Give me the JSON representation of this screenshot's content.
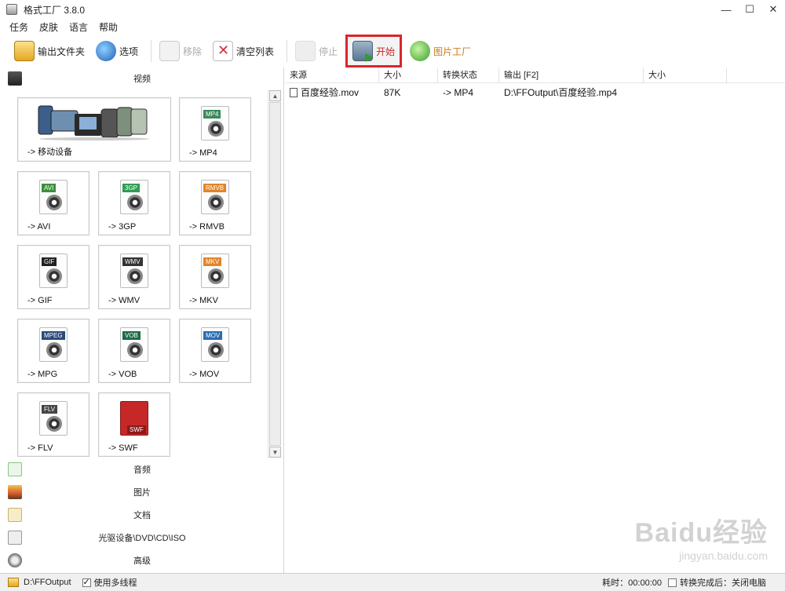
{
  "window": {
    "title": "格式工厂 3.8.0",
    "controls": [
      "—",
      "☐",
      "✕"
    ]
  },
  "menu": [
    "任务",
    "皮肤",
    "语言",
    "帮助"
  ],
  "toolbar": {
    "output_folder": "输出文件夹",
    "options": "选项",
    "remove": "移除",
    "clear_list": "清空列表",
    "stop": "停止",
    "start": "开始",
    "picture_factory": "图片工厂"
  },
  "categories": {
    "video": "视频",
    "audio": "音频",
    "image": "图片",
    "document": "文档",
    "disc": "光驱设备\\DVD\\CD\\ISO",
    "advanced": "高级"
  },
  "video_tiles": [
    {
      "label": "-> 移动设备",
      "tag": "",
      "icon": "mobile-devices-icon"
    },
    {
      "label": "-> MP4",
      "tag": "MP4",
      "tag_color": "#3a8a5c",
      "icon": "mp4-icon"
    },
    {
      "label": "-> AVI",
      "tag": "AVI",
      "tag_color": "#3c8f3c",
      "icon": "avi-icon"
    },
    {
      "label": "-> 3GP",
      "tag": "3GP",
      "tag_color": "#2f9d52",
      "icon": "3gp-icon"
    },
    {
      "label": "-> RMVB",
      "tag": "RMVB",
      "tag_color": "#e48427",
      "icon": "rmvb-icon"
    },
    {
      "label": "-> GIF",
      "tag": "GIF",
      "tag_color": "#222222",
      "icon": "gif-icon"
    },
    {
      "label": "-> WMV",
      "tag": "WMV",
      "tag_color": "#333333",
      "icon": "wmv-icon"
    },
    {
      "label": "-> MKV",
      "tag": "MKV",
      "tag_color": "#e48427",
      "icon": "mkv-icon"
    },
    {
      "label": "-> MPG",
      "tag": "MPEG",
      "tag_color": "#2d4a7a",
      "icon": "mpg-icon"
    },
    {
      "label": "-> VOB",
      "tag": "VOB",
      "tag_color": "#1e6b46",
      "icon": "vob-icon"
    },
    {
      "label": "-> MOV",
      "tag": "MOV",
      "tag_color": "#2a6db0",
      "icon": "mov-icon"
    },
    {
      "label": "-> FLV",
      "tag": "FLV",
      "tag_color": "#444444",
      "icon": "flv-icon"
    },
    {
      "label": "-> SWF",
      "tag": "SWF",
      "tag_color": "#c62828",
      "icon": "swf-icon"
    }
  ],
  "table": {
    "columns": [
      "来源",
      "大小",
      "转换状态",
      "输出 [F2]",
      "大小"
    ],
    "rows": [
      {
        "source": "百度经验.mov",
        "size": "87K",
        "status": "-> MP4",
        "output": "D:\\FFOutput\\百度经验.mp4",
        "out_size": ""
      }
    ]
  },
  "watermark": {
    "logo": "Baidu经验",
    "url": "jingyan.baidu.com"
  },
  "statusbar": {
    "path": "D:\\FFOutput",
    "multithread_label": "使用多线程",
    "multithread_checked": true,
    "elapsed": "耗时：00:00:00",
    "after_label": "转换完成后：关闭电脑",
    "after_checked": false
  }
}
